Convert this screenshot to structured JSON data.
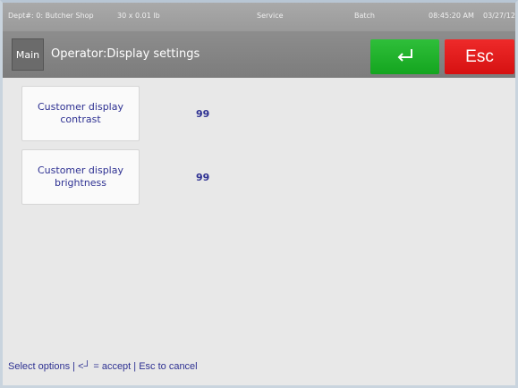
{
  "status_bar": {
    "department": "Dept#: 0: Butcher Shop",
    "scale": "30 x 0.01 lb",
    "mode": "Service",
    "batch": "Batch",
    "time": "08:45:20 AM",
    "date": "03/27/12"
  },
  "header": {
    "main_label": "Main",
    "title": "Operator:Display settings",
    "accept_icon": "enter-arrow-icon",
    "esc_label": "Esc"
  },
  "settings": [
    {
      "label": "Customer display contrast",
      "value": "99"
    },
    {
      "label": "Customer display brightness",
      "value": "99"
    }
  ],
  "footer": {
    "hint": "Select options | <┘ = accept | Esc to cancel"
  },
  "colors": {
    "accept": "#1fb02a",
    "esc": "#e01818",
    "text_blue": "#2e3192",
    "header_gray": "#858585"
  }
}
